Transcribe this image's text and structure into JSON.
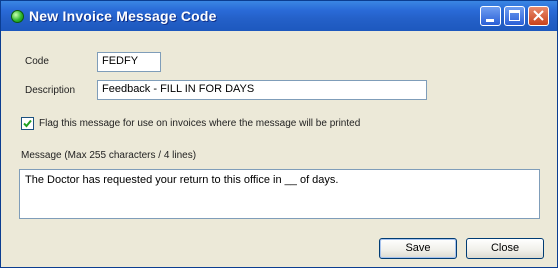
{
  "window": {
    "title": "New Invoice Message Code",
    "title_icon": "green-circle-icon",
    "controls": {
      "minimize_icon": "minimize-icon",
      "maximize_icon": "maximize-icon",
      "close_icon": "close-icon"
    }
  },
  "form": {
    "code_label": "Code",
    "code_value": "FEDFY",
    "description_label": "Description",
    "description_value": "Feedback - FILL IN FOR DAYS",
    "checkbox": {
      "checked": true,
      "label": "Flag this message for use on invoices where the message will be printed",
      "icon": "checkmark-icon"
    },
    "message_label": "Message (Max 255 characters / 4 lines)",
    "message_value": "The Doctor has requested your return to this office in __ of days."
  },
  "buttons": {
    "save_label": "Save",
    "close_label": "Close"
  },
  "colors": {
    "titlebar": "#2460c8",
    "window_bg": "#ece9d8",
    "field_border": "#7f9db9",
    "check_green": "#21a121"
  }
}
